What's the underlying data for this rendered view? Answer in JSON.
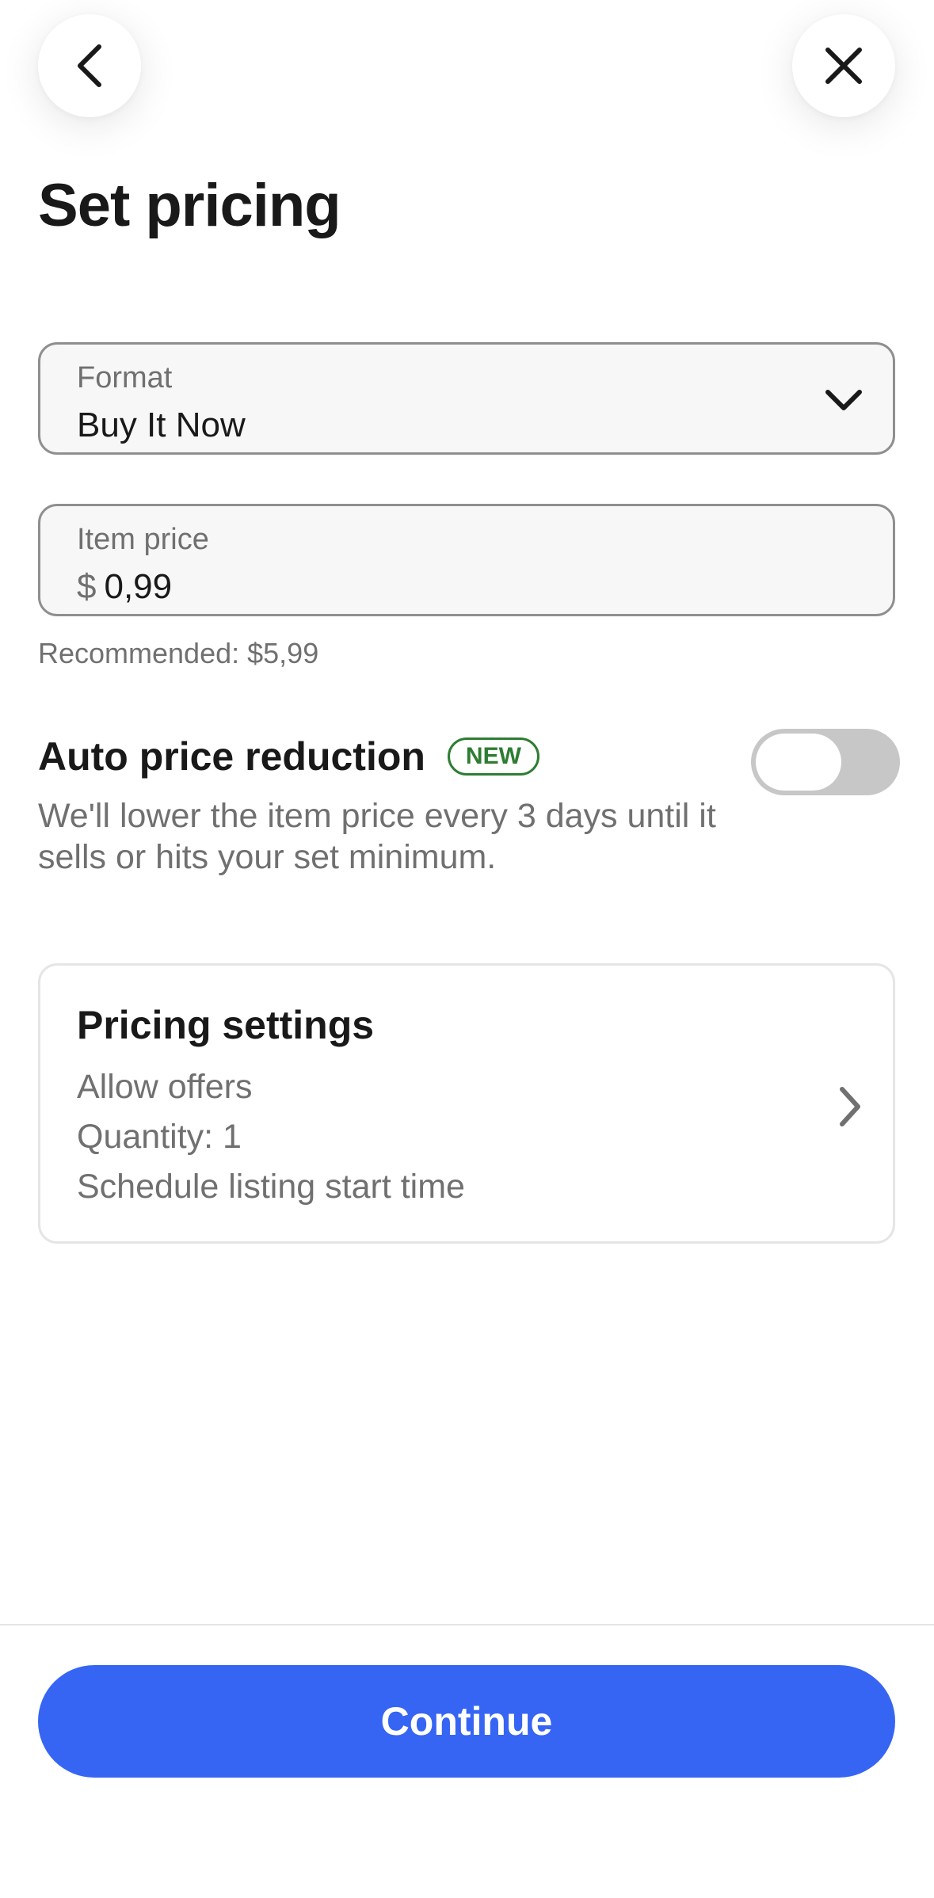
{
  "header": {
    "back_icon": "chevron-left-icon",
    "close_icon": "close-icon",
    "title": "Set pricing"
  },
  "format_field": {
    "label": "Format",
    "value": "Buy It Now",
    "icon": "chevron-down-icon"
  },
  "price_field": {
    "label": "Item price",
    "currency": "$",
    "value": "0,99",
    "recommended": "Recommended: $5,99"
  },
  "auto_price_reduction": {
    "title": "Auto price reduction",
    "badge": "NEW",
    "description": "We'll lower the item price every 3 days until it sells or hits your set minimum.",
    "enabled": false
  },
  "pricing_settings": {
    "title": "Pricing settings",
    "lines": [
      "Allow offers",
      "Quantity: 1",
      "Schedule listing start time"
    ],
    "icon": "chevron-right-icon"
  },
  "footer": {
    "continue_label": "Continue"
  },
  "colors": {
    "primary": "#3665f3",
    "badge_green": "#2e7d32",
    "text": "#191919",
    "muted": "#707070",
    "toggle_off": "#c7c7c7"
  }
}
